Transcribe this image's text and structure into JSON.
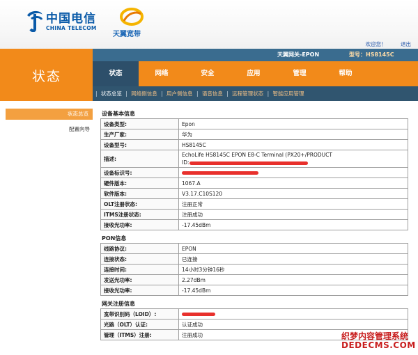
{
  "header": {
    "brand_cn": "中国电信",
    "brand_en": "CHINA TELECOM",
    "sub_brand": "天翼宽带",
    "welcome": "欢迎您！",
    "logout": "退出"
  },
  "topbar": {
    "gateway_name": "天翼网关-EPON",
    "model": "型号：HS8145C"
  },
  "page_heading": "状态",
  "nav": {
    "items": [
      "状态",
      "网络",
      "安全",
      "应用",
      "管理",
      "帮助"
    ],
    "active": "状态"
  },
  "subnav": {
    "items": [
      "状态总览",
      "网络侧信息",
      "用户侧信息",
      "语音信息",
      "远程管理状态",
      "智能应用管理"
    ]
  },
  "sidebar": {
    "items": [
      "状态总览",
      "配置向导"
    ]
  },
  "device_info": {
    "title": "设备基本信息",
    "rows": [
      {
        "k": "设备类型:",
        "v": "Epon"
      },
      {
        "k": "生产厂家:",
        "v": "华为"
      },
      {
        "k": "设备型号:",
        "v": "HS8145C"
      },
      {
        "k": "描述:",
        "v": "EchoLife HS8145C EPON E8-C Terminal (PX20+/PRODUCT",
        "v2": "ID:"
      },
      {
        "k": "设备标识号:",
        "v": ""
      },
      {
        "k": "硬件版本:",
        "v": "1067.A"
      },
      {
        "k": "软件版本:",
        "v": "V3.17.C10S120"
      },
      {
        "k": "OLT注册状态:",
        "v": "注册正常"
      },
      {
        "k": "ITMS注册状态:",
        "v": "注册成功"
      },
      {
        "k": "接收光功率:",
        "v": "-17.45dBm"
      }
    ]
  },
  "pon_info": {
    "title": "PON信息",
    "rows": [
      {
        "k": "线路协议:",
        "v": "EPON"
      },
      {
        "k": "连接状态:",
        "v": "已连接"
      },
      {
        "k": "连接时间:",
        "v": "14小时3分钟16秒"
      },
      {
        "k": "发送光功率:",
        "v": "2.27dBm"
      },
      {
        "k": "接收光功率:",
        "v": "-17.45dBm"
      }
    ]
  },
  "gw_reg": {
    "title": "网关注册信息",
    "rows": [
      {
        "k": "宽带识别码（LOID）:",
        "v": ""
      },
      {
        "k": "光路（OLT）认证:",
        "v": "认证成功"
      },
      {
        "k": "管理（ITMS）注册:",
        "v": "注册成功"
      }
    ]
  },
  "watermark": {
    "line1": "织梦内容管理系统",
    "line2": "DEDECMS.COM"
  },
  "colors": {
    "orange": "#f28a1a",
    "nav_active": "#2d4f6a",
    "brand_blue": "#0a5aa8",
    "redaction": "#e8302c"
  }
}
